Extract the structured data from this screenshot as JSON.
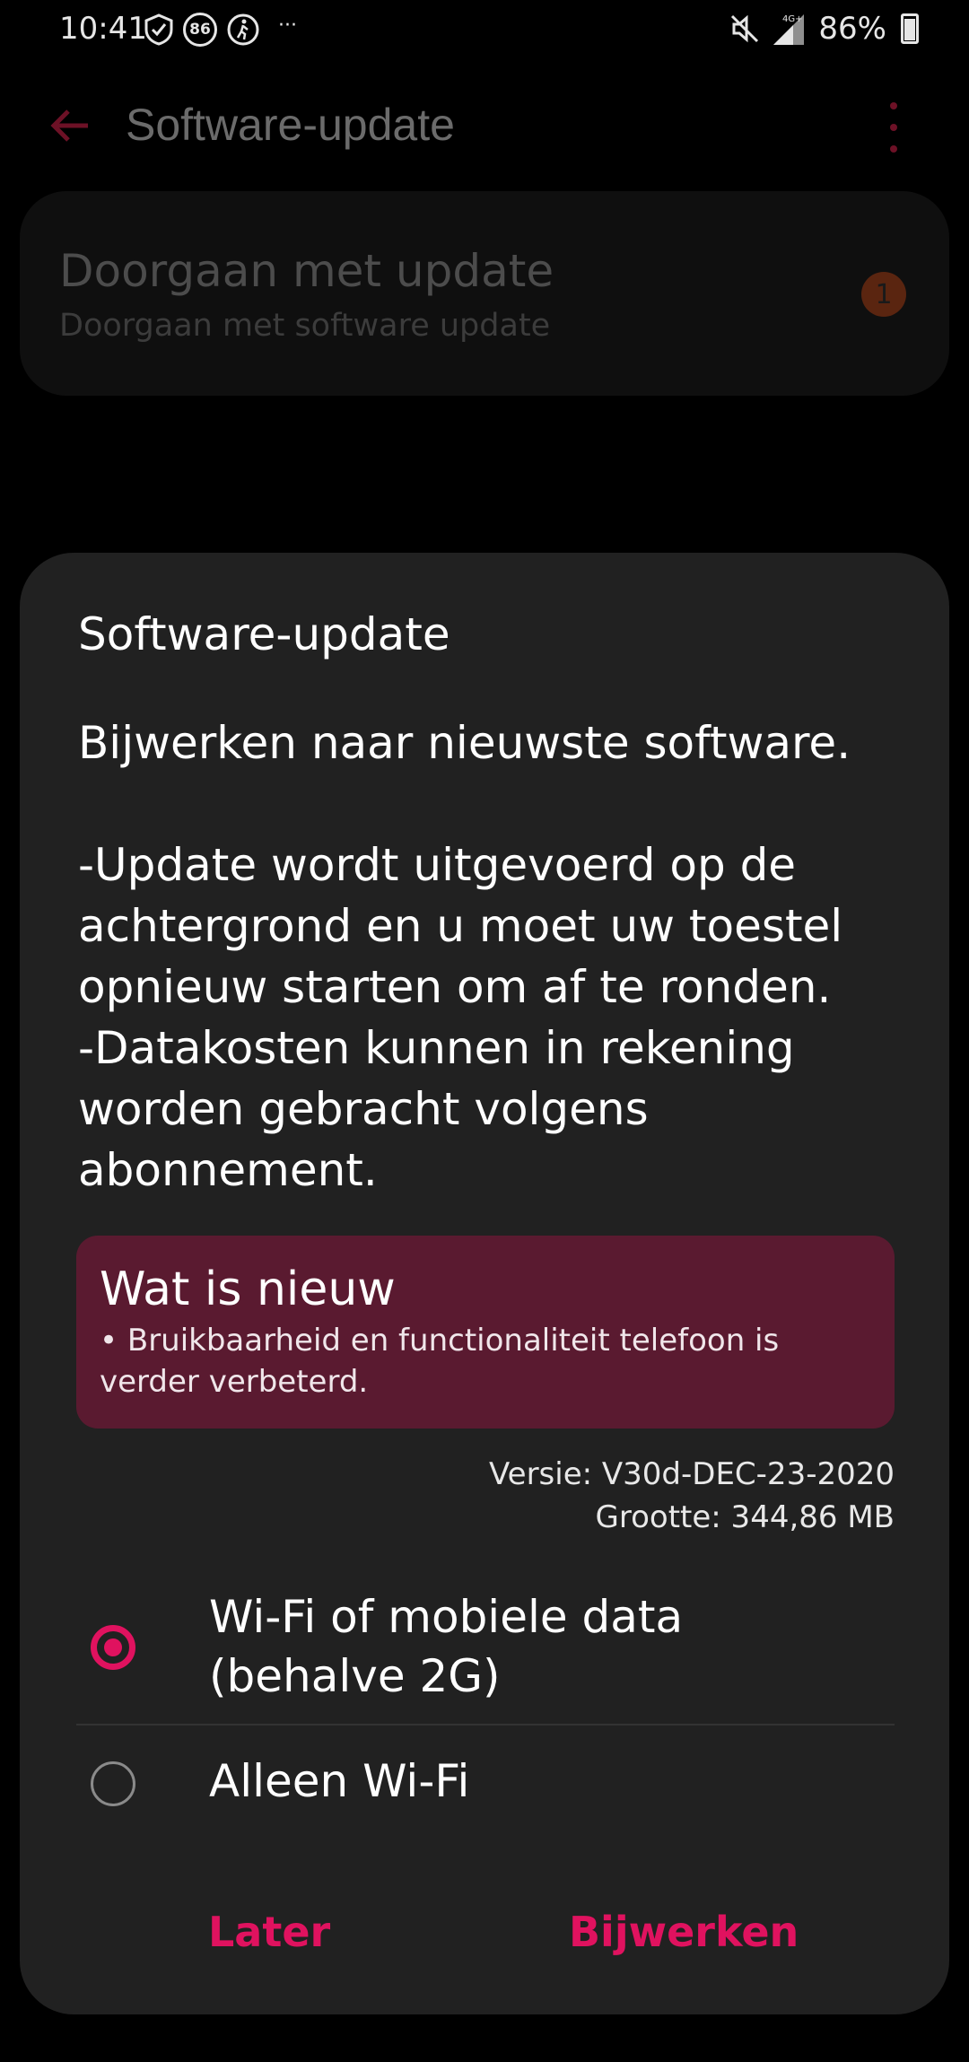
{
  "status_bar": {
    "time": "10:41",
    "badge_number": "86",
    "more": "···",
    "network": "4G+",
    "battery": "86%"
  },
  "app_bar": {
    "title": "Software-update"
  },
  "background_item": {
    "title": "Doorgaan met update",
    "subtitle": "Doorgaan met software update",
    "badge": "1"
  },
  "dialog": {
    "title": "Software-update",
    "body": "Bijwerken naar nieuwste software.\n\n-Update wordt uitgevoerd op de achtergrond en u moet uw toestel opnieuw starten om af te ronden.\n-Datakosten kunnen in rekening worden gebracht volgens abonnement.",
    "whats_new": {
      "title": "Wat is nieuw",
      "text": "• Bruikbaarheid en functionaliteit telefoon is verder verbeterd."
    },
    "version": "Versie: V30d-DEC-23-2020",
    "size": "Grootte: 344,86 MB",
    "options": [
      {
        "label": "Wi-Fi of mobiele data (behalve 2G)",
        "selected": true
      },
      {
        "label": "Alleen Wi-Fi",
        "selected": false
      }
    ],
    "buttons": {
      "later": "Later",
      "update": "Bijwerken"
    }
  },
  "colors": {
    "accent": "#e0125f",
    "dialog_bg": "#212121",
    "whats_new_bg": "#5a1a30"
  }
}
